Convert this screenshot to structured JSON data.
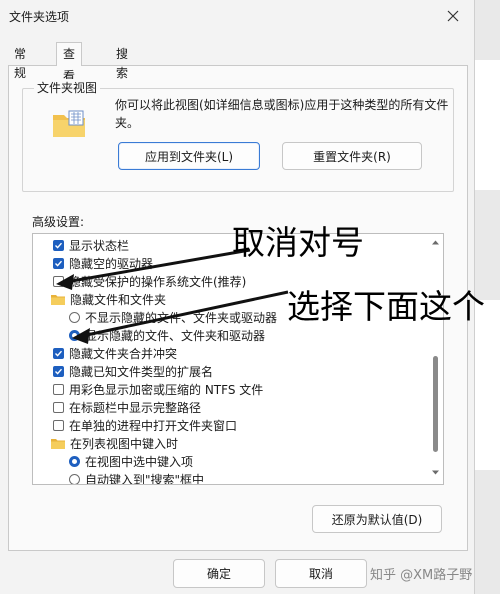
{
  "window": {
    "title": "文件夹选项"
  },
  "tabs": [
    {
      "label": "常规",
      "active": false
    },
    {
      "label": "查看",
      "active": true
    },
    {
      "label": "搜索",
      "active": false
    }
  ],
  "folder_views": {
    "label": "文件夹视图",
    "description": "你可以将此视图(如详细信息或图标)应用于这种类型的所有文件夹。",
    "apply_button": "应用到文件夹(L)",
    "reset_button": "重置文件夹(R)"
  },
  "advanced": {
    "label": "高级设置:",
    "items": [
      {
        "type": "checkbox",
        "checked": true,
        "label": "显示状态栏"
      },
      {
        "type": "checkbox",
        "checked": true,
        "label": "隐藏空的驱动器"
      },
      {
        "type": "checkbox",
        "checked": false,
        "label": "隐藏受保护的操作系统文件(推荐)"
      },
      {
        "type": "folder",
        "label": "隐藏文件和文件夹"
      },
      {
        "type": "radio",
        "checked": false,
        "label": "不显示隐藏的文件、文件夹或驱动器"
      },
      {
        "type": "radio",
        "checked": true,
        "label": "显示隐藏的文件、文件夹和驱动器"
      },
      {
        "type": "checkbox",
        "checked": true,
        "label": "隐藏文件夹合并冲突"
      },
      {
        "type": "checkbox",
        "checked": true,
        "label": "隐藏已知文件类型的扩展名"
      },
      {
        "type": "checkbox",
        "checked": false,
        "label": "用彩色显示加密或压缩的 NTFS 文件"
      },
      {
        "type": "checkbox",
        "checked": false,
        "label": "在标题栏中显示完整路径"
      },
      {
        "type": "checkbox",
        "checked": false,
        "label": "在单独的进程中打开文件夹窗口"
      },
      {
        "type": "folder",
        "label": "在列表视图中键入时"
      },
      {
        "type": "radio",
        "checked": true,
        "label": "在视图中选中键入项"
      },
      {
        "type": "radio",
        "checked": false,
        "label": "自动键入到\"搜索\"框中"
      }
    ],
    "restore_defaults_button": "还原为默认值(D)"
  },
  "footer": {
    "ok_button": "确定",
    "cancel_button": "取消"
  },
  "annotations": {
    "uncheck": "取消对号",
    "choose_below": "选择下面这个"
  },
  "watermark": "知乎 @XM路子野",
  "colors": {
    "accent": "#1e5fbf",
    "panel": "#fafafa",
    "window": "#f3f3f3"
  },
  "icons": [
    "close-icon",
    "folder-options-icon",
    "folder-icon",
    "scroll-up-icon",
    "scroll-down-icon"
  ]
}
